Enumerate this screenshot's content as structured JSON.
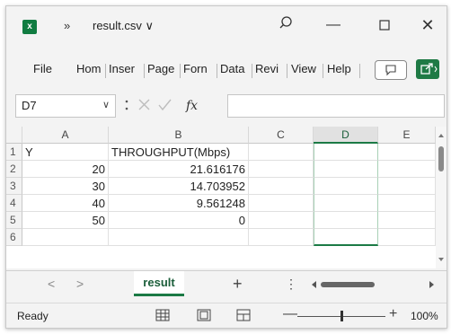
{
  "app": {
    "logo_letter": "x",
    "file_title": "result.csv ∨",
    "overflow_glyph": "»"
  },
  "window_controls": {
    "minimize": "—",
    "close": "✕"
  },
  "ribbon": {
    "tabs": [
      "File",
      "Hom",
      "Inser",
      "Page",
      "Forn",
      "Data",
      "Revi",
      "View",
      "Help"
    ]
  },
  "formula_bar": {
    "name_box": "D7",
    "name_box_caret": "∨",
    "value": ""
  },
  "grid": {
    "columns": [
      "A",
      "B",
      "C",
      "D",
      "E"
    ],
    "selected_column": "D",
    "row_numbers": [
      "1",
      "2",
      "3",
      "4",
      "5",
      "6"
    ],
    "rows": [
      {
        "a": "Y",
        "b": "THROUGHPUT(Mbps)"
      },
      {
        "a": "20",
        "b": "21.616176"
      },
      {
        "a": "30",
        "b": "14.703952"
      },
      {
        "a": "40",
        "b": "9.561248"
      },
      {
        "a": "50",
        "b": "0"
      },
      {
        "a": "",
        "b": ""
      }
    ]
  },
  "sheet_tabs": {
    "active": "result",
    "add": "+",
    "more": "⋮",
    "prev": "<",
    "next": ">"
  },
  "status_bar": {
    "status": "Ready",
    "zoom": "100%",
    "zoom_minus": "—",
    "zoom_plus": "+",
    "zoom_level": 0.5
  },
  "colors": {
    "excel_green": "#107c41",
    "selection_green": "#1b7a45"
  }
}
